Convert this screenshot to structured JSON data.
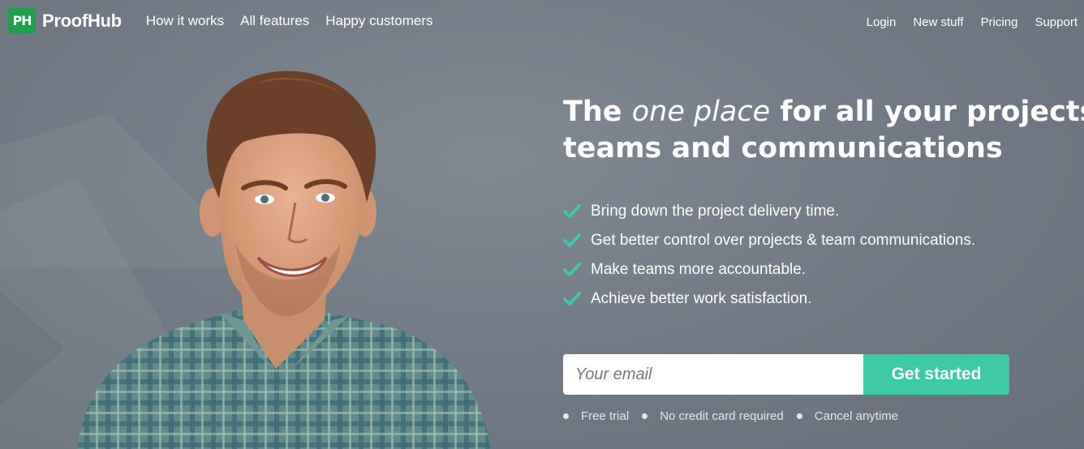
{
  "brand": {
    "logo_mark": "PH",
    "name": "ProofHub",
    "accent": "#1f9e4c"
  },
  "main_nav": [
    "How it works",
    "All features",
    "Happy customers"
  ],
  "top_links": [
    "Login",
    "New stuff",
    "Pricing",
    "Support"
  ],
  "hero": {
    "headline_pre": "The ",
    "headline_em": "one place",
    "headline_line1_post": " for all your projects,",
    "headline_line2": "teams and communications",
    "benefits": [
      "Bring down the project delivery time.",
      "Get better control over projects & team communications.",
      "Make teams more accountable.",
      "Achieve better work satisfaction."
    ],
    "check_icon": "check-icon",
    "check_color": "#3ec9a6"
  },
  "signup": {
    "email_placeholder": "Your email",
    "email_value": "",
    "button_label": "Get started",
    "button_color": "#3ec9a6"
  },
  "perks": [
    "Free trial",
    "No credit card required",
    "Cancel anytime"
  ],
  "hero_image": "smiling-man-plaid-shirt"
}
